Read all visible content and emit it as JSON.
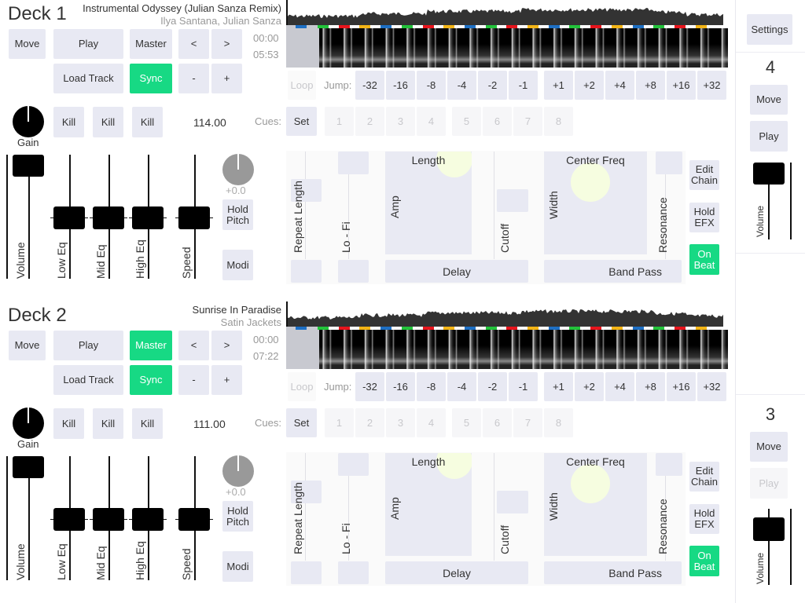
{
  "decks": [
    {
      "title": "Deck 1",
      "track_title": "Instrumental Odyssey (Julian Sanza Remix)",
      "track_artist": "Ilya Santana, Julian Sanza",
      "time_elapsed": "00:00",
      "time_total": "05:53",
      "bpm": "114.00",
      "pitch": "+0.0",
      "volume_level": 1.0,
      "eq_levels": {
        "low": 0.5,
        "mid": 0.5,
        "high": 0.5,
        "speed": 0.5
      }
    },
    {
      "title": "Deck 2",
      "track_title": "Sunrise In Paradise",
      "track_artist": "Satin Jackets",
      "time_elapsed": "00:00",
      "time_total": "07:22",
      "bpm": "111.00",
      "pitch": "+0.0",
      "volume_level": 1.0,
      "eq_levels": {
        "low": 0.5,
        "mid": 0.5,
        "high": 0.5,
        "speed": 0.5
      }
    }
  ],
  "labels": {
    "move": "Move",
    "play": "Play",
    "master": "Master",
    "prev": "<",
    "next": ">",
    "load_track": "Load Track",
    "sync": "Sync",
    "minus": "-",
    "plus": "+",
    "gain": "Gain",
    "kill": "Kill",
    "loop": "Loop",
    "jump": "Jump:",
    "cues": "Cues:",
    "set": "Set",
    "volume": "Volume",
    "low_eq": "Low Eq",
    "mid_eq": "Mid Eq",
    "high_eq": "High Eq",
    "speed": "Speed",
    "hold_pitch": "Hold Pitch",
    "modi": "Modi",
    "repeat_length": "Repeat Length",
    "lo_fi": "Lo - Fi",
    "length": "Length",
    "amp": "Amp",
    "cutoff": "Cutoff",
    "delay": "Delay",
    "center_freq": "Center Freq",
    "width": "Width",
    "resonance": "Resonance",
    "band_pass": "Band Pass",
    "edit_chain": "Edit Chain",
    "hold_efx": "Hold EFX",
    "on_beat": "On Beat"
  },
  "jump_values": [
    "-32",
    "-16",
    "-8",
    "-4",
    "-2",
    "-1",
    "+1",
    "+2",
    "+4",
    "+8",
    "+16",
    "+32"
  ],
  "cue_slots": [
    "1",
    "2",
    "3",
    "4",
    "5",
    "6",
    "7",
    "8"
  ],
  "side": {
    "settings": "Settings",
    "decks": [
      {
        "number": "4",
        "move": "Move",
        "play": "Play",
        "play_enabled": true,
        "volume": "Volume",
        "volume_level": 1.0
      },
      {
        "number": "3",
        "move": "Move",
        "play": "Play",
        "play_enabled": false,
        "volume": "Volume",
        "volume_level": 0.85
      }
    ]
  },
  "colors": {
    "accent": "#17d984",
    "button": "#e8e9f3",
    "beat_markers": [
      "#22c33a",
      "#e8141c",
      "#f3b415",
      "#1d6fc4"
    ]
  }
}
